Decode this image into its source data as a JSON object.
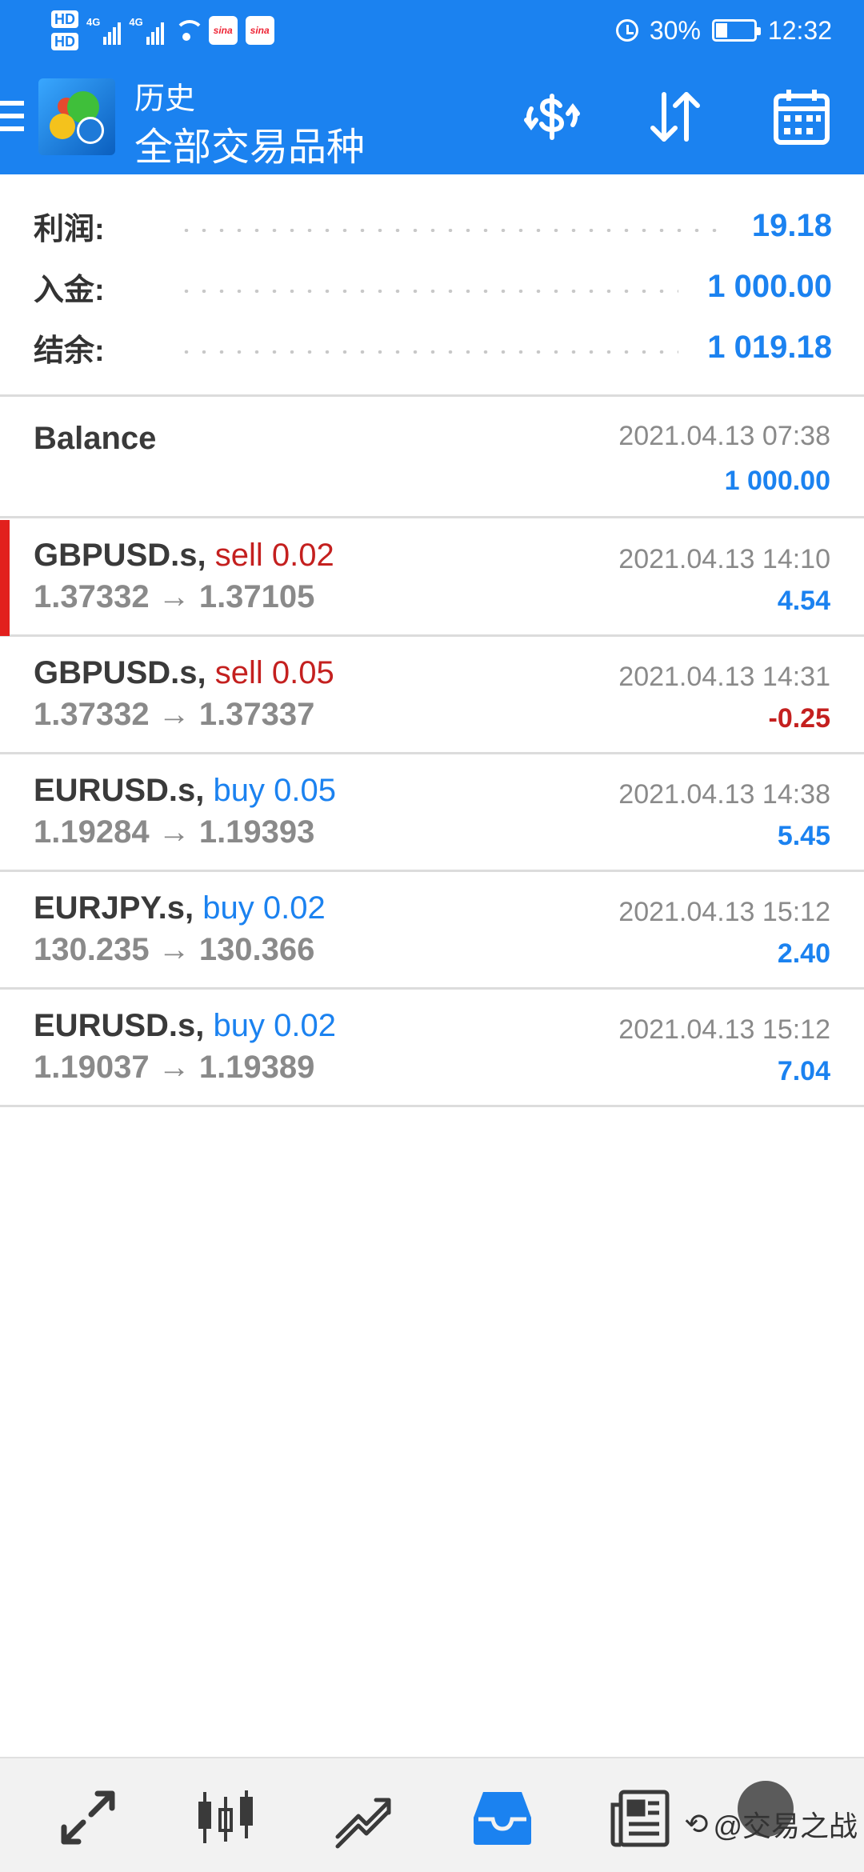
{
  "status_bar": {
    "hd1": "HD",
    "hd2": "HD",
    "net1": "4G",
    "net2": "4G",
    "sina1": "sina",
    "sina2": "sina",
    "battery": "30%",
    "battery_level": 0.3,
    "time": "12:32"
  },
  "app_bar": {
    "title_small": "历史",
    "title_large": "全部交易品种",
    "icons": [
      "currency-exchange-icon",
      "sort-icon",
      "calendar-icon"
    ]
  },
  "summary": {
    "rows": [
      {
        "label": "利润:",
        "value": "19.18"
      },
      {
        "label": "入金:",
        "value": "1 000.00"
      },
      {
        "label": "结余:",
        "value": "1 019.18"
      }
    ]
  },
  "balance": {
    "title": "Balance",
    "time": "2021.04.13 07:38",
    "amount": "1 000.00"
  },
  "deals": [
    {
      "symbol": "GBPUSD.s,",
      "side": "sell 0.02",
      "side_type": "sell",
      "prices": "1.37332 → 1.37105",
      "time": "2021.04.13 14:10",
      "profit": "4.54",
      "profit_sign": "pos",
      "selected": true
    },
    {
      "symbol": "GBPUSD.s,",
      "side": "sell 0.05",
      "side_type": "sell",
      "prices": "1.37332 → 1.37337",
      "time": "2021.04.13 14:31",
      "profit": "-0.25",
      "profit_sign": "neg",
      "selected": false
    },
    {
      "symbol": "EURUSD.s,",
      "side": "buy 0.05",
      "side_type": "buy",
      "prices": "1.19284 → 1.19393",
      "time": "2021.04.13 14:38",
      "profit": "5.45",
      "profit_sign": "pos",
      "selected": false
    },
    {
      "symbol": "EURJPY.s,",
      "side": "buy 0.02",
      "side_type": "buy",
      "prices": "130.235 → 130.366",
      "time": "2021.04.13 15:12",
      "profit": "2.40",
      "profit_sign": "pos",
      "selected": false
    },
    {
      "symbol": "EURUSD.s,",
      "side": "buy 0.02",
      "side_type": "buy",
      "prices": "1.19037 → 1.19389",
      "time": "2021.04.13 15:12",
      "profit": "7.04",
      "profit_sign": "pos",
      "selected": false
    }
  ],
  "bottom_nav": {
    "items": [
      "quotes-icon",
      "chart-icon",
      "trade-icon",
      "history-icon",
      "news-icon"
    ],
    "active": "history-icon",
    "watermark": "@交易之战"
  },
  "colors": {
    "primary": "#1b82f0",
    "sell": "#c4201f",
    "selected_marker": "#e2201d"
  }
}
